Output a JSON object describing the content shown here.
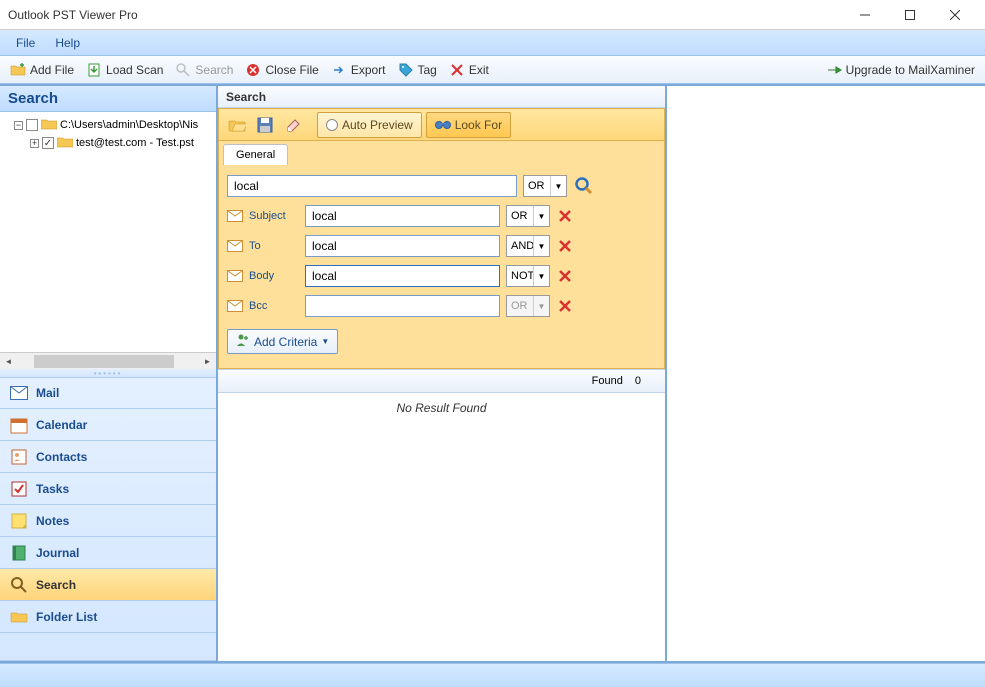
{
  "window": {
    "title": "Outlook PST Viewer Pro"
  },
  "menu": {
    "file": "File",
    "help": "Help"
  },
  "toolbar": {
    "add_file": "Add File",
    "load_scan": "Load Scan",
    "search": "Search",
    "close_file": "Close File",
    "export": "Export",
    "tag": "Tag",
    "exit": "Exit",
    "upgrade": "Upgrade to MailXaminer"
  },
  "left": {
    "header": "Search",
    "tree": {
      "root": "C:\\Users\\admin\\Desktop\\Nis",
      "child": "test@test.com - Test.pst"
    },
    "nav": {
      "mail": "Mail",
      "calendar": "Calendar",
      "contacts": "Contacts",
      "tasks": "Tasks",
      "notes": "Notes",
      "journal": "Journal",
      "search": "Search",
      "folder_list": "Folder List"
    }
  },
  "mid": {
    "header": "Search",
    "auto_preview": "Auto Preview",
    "look_for": "Look For",
    "tab_general": "General",
    "main_input": "local",
    "main_op": "OR",
    "rows": [
      {
        "label": "Subject",
        "value": "local",
        "op": "OR"
      },
      {
        "label": "To",
        "value": "local",
        "op": "AND"
      },
      {
        "label": "Body",
        "value": "local",
        "op": "NOT"
      },
      {
        "label": "Bcc",
        "value": "",
        "op": "OR"
      }
    ],
    "add_criteria": "Add Criteria",
    "found_label": "Found",
    "found_count": "0",
    "no_result": "No Result Found"
  }
}
